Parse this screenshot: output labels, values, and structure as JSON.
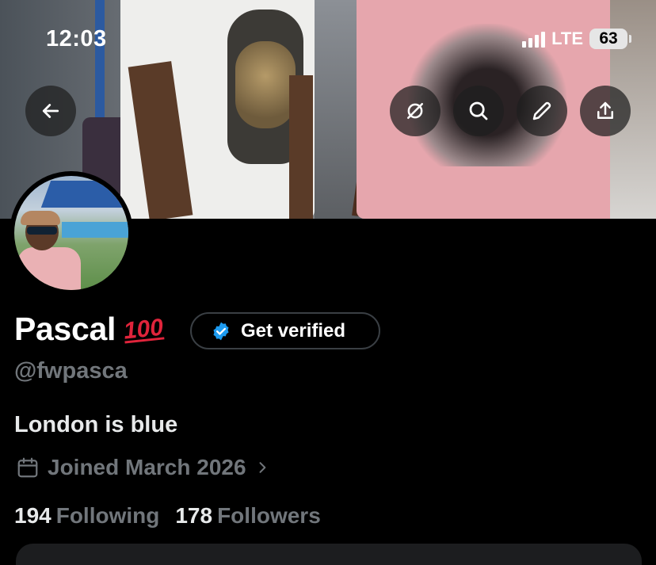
{
  "status_bar": {
    "time": "12:03",
    "network": "LTE",
    "battery": "63"
  },
  "header": {
    "back_icon": "arrow-left-icon",
    "actions": [
      "circle-slash-icon",
      "search-icon",
      "pencil-icon",
      "share-icon"
    ]
  },
  "profile": {
    "name": "Pascal",
    "name_emoji": "100",
    "verify_label": "Get verified",
    "handle": "@fwpasca",
    "bio": "London is blue",
    "joined": "Joined March 2026",
    "following_count": "194",
    "following_label": "Following",
    "followers_count": "178",
    "followers_label": "Followers"
  },
  "colors": {
    "background": "#000000",
    "text_primary": "#e7e9ea",
    "text_secondary": "#71767b",
    "verified_blue": "#1d9bf0",
    "emoji_red": "#e0243b"
  }
}
